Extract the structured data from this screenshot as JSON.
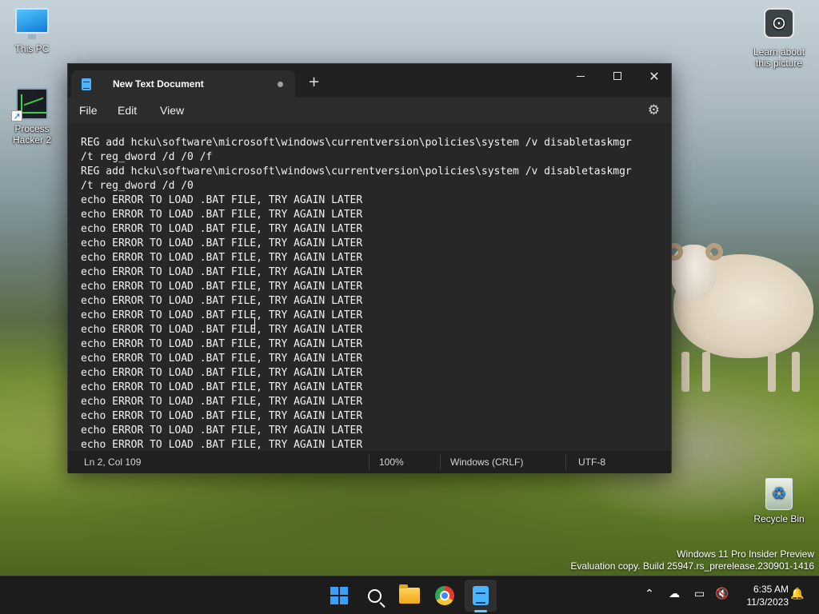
{
  "desktop": {
    "icons": [
      {
        "label": "This PC",
        "icon": "monitor-icon"
      },
      {
        "label": "Process\nHacker 2",
        "icon": "process-hacker-icon"
      },
      {
        "label": "Learn about\nthis picture",
        "icon": "camera-icon"
      },
      {
        "label": "Recycle Bin",
        "icon": "recycle-bin-icon"
      }
    ],
    "watermark": {
      "line1": "Windows 11 Pro Insider Preview",
      "line2": "Evaluation copy. Build 25947.rs_prerelease.230901-1416"
    }
  },
  "notepad": {
    "tab_title": "New Text Document",
    "new_tab_symbol": "+",
    "menu": {
      "file": "File",
      "edit": "Edit",
      "view": "View"
    },
    "lines": [
      "REG add hcku\\software\\microsoft\\windows\\currentversion\\policies\\system /v disabletaskmgr",
      "/t reg_dword /d /0 /f",
      "REG add hcku\\software\\microsoft\\windows\\currentversion\\policies\\system /v disabletaskmgr",
      "/t reg_dword /d /0",
      "echo ERROR TO LOAD .BAT FILE, TRY AGAIN LATER",
      "echo ERROR TO LOAD .BAT FILE, TRY AGAIN LATER",
      "echo ERROR TO LOAD .BAT FILE, TRY AGAIN LATER",
      "echo ERROR TO LOAD .BAT FILE, TRY AGAIN LATER",
      "echo ERROR TO LOAD .BAT FILE, TRY AGAIN LATER",
      "echo ERROR TO LOAD .BAT FILE, TRY AGAIN LATER",
      "echo ERROR TO LOAD .BAT FILE, TRY AGAIN LATER",
      "echo ERROR TO LOAD .BAT FILE, TRY AGAIN LATER",
      "echo ERROR TO LOAD .BAT FILE, TRY AGAIN LATER",
      "echo ERROR TO LOAD .BAT FILE, TRY AGAIN LATER",
      "echo ERROR TO LOAD .BAT FILE, TRY AGAIN LATER",
      "echo ERROR TO LOAD .BAT FILE, TRY AGAIN LATER",
      "echo ERROR TO LOAD .BAT FILE, TRY AGAIN LATER",
      "echo ERROR TO LOAD .BAT FILE, TRY AGAIN LATER",
      "echo ERROR TO LOAD .BAT FILE, TRY AGAIN LATER",
      "echo ERROR TO LOAD .BAT FILE, TRY AGAIN LATER",
      "echo ERROR TO LOAD .BAT FILE, TRY AGAIN LATER",
      "echo ERROR TO LOAD .BAT FILE, TRY AGAIN LATER"
    ],
    "status": {
      "position": "Ln 2, Col 109",
      "zoom": "100%",
      "line_ending": "Windows (CRLF)",
      "encoding": "UTF-8"
    }
  },
  "taskbar": {
    "apps": [
      "start-icon",
      "search-icon",
      "file-explorer-icon",
      "chrome-icon",
      "notepad-icon"
    ],
    "clock": {
      "time": "6:35 AM",
      "date": "11/3/2023"
    }
  }
}
